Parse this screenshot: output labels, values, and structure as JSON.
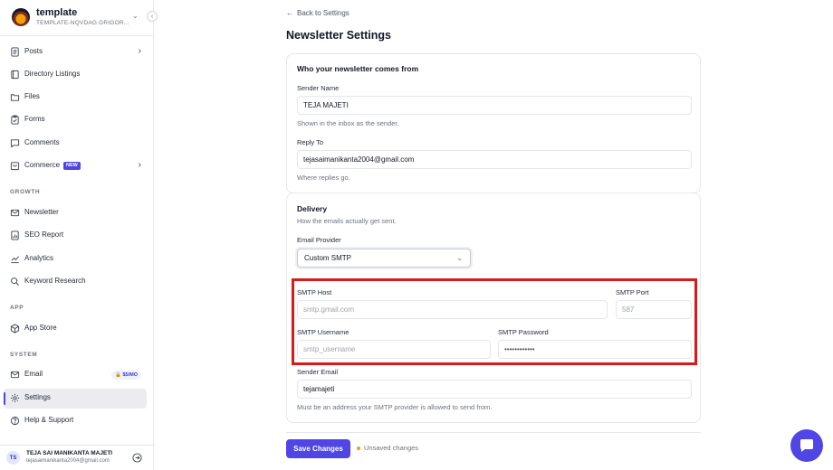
{
  "workspace": {
    "name": "template",
    "subtitle": "TEMPLATE-NQVDAG.GRIGOR..."
  },
  "sidebar": {
    "items": [
      {
        "label": "Posts",
        "icon": "file-text-icon"
      },
      {
        "label": "Directory Listings",
        "icon": "book-icon"
      },
      {
        "label": "Files",
        "icon": "folder-icon"
      },
      {
        "label": "Forms",
        "icon": "clipboard-icon"
      },
      {
        "label": "Comments",
        "icon": "message-icon"
      },
      {
        "label": "Commerce",
        "icon": "cart-icon",
        "badge": "NEW"
      }
    ],
    "growth_title": "GROWTH",
    "growth": [
      {
        "label": "Newsletter",
        "icon": "mail-icon"
      },
      {
        "label": "SEO Report",
        "icon": "report-icon"
      },
      {
        "label": "Analytics",
        "icon": "chart-icon"
      },
      {
        "label": "Keyword Research",
        "icon": "search-icon"
      }
    ],
    "app_title": "APP",
    "app": [
      {
        "label": "App Store",
        "icon": "box-icon"
      }
    ],
    "system_title": "SYSTEM",
    "system": [
      {
        "label": "Email",
        "icon": "mail-icon",
        "badge": "$5/MO"
      },
      {
        "label": "Settings",
        "icon": "gear-icon",
        "active": true
      },
      {
        "label": "Help & Support",
        "icon": "help-icon"
      }
    ],
    "user": {
      "initials": "TS",
      "name": "TEJA SAI MANIKANTA MAJETI",
      "email": "tejasaimanikanta2004@gmail.com"
    }
  },
  "main": {
    "back_label": "Back to Settings",
    "title": "Newsletter Settings",
    "from_card": {
      "title": "Who your newsletter comes from",
      "sender_name_label": "Sender Name",
      "sender_name_value": "TEJA MAJETI",
      "sender_name_hint": "Shown in the inbox as the sender.",
      "reply_to_label": "Reply To",
      "reply_to_value": "tejasaimanikanta2004@gmail.com",
      "reply_to_hint": "Where replies go."
    },
    "delivery_card": {
      "title": "Delivery",
      "subtitle": "How the emails actually get sent.",
      "provider_label": "Email Provider",
      "provider_value": "Custom SMTP",
      "smtp_host_label": "SMTP Host",
      "smtp_host_placeholder": "smtp.gmail.com",
      "smtp_port_label": "SMTP Port",
      "smtp_port_placeholder": "587",
      "smtp_username_label": "SMTP Username",
      "smtp_username_placeholder": "smtp_username",
      "smtp_password_label": "SMTP Password",
      "smtp_password_value": "••••••••••••",
      "sender_email_label": "Sender Email",
      "sender_email_value": "tejamajeti",
      "sender_email_hint": "Must be an address your SMTP provider is allowed to send from."
    },
    "save_label": "Save Changes",
    "unsaved_label": "Unsaved changes"
  },
  "colors": {
    "accent": "#4f46e5",
    "highlight": "#d91a1a",
    "unsaved_dot": "#f59e0b"
  }
}
